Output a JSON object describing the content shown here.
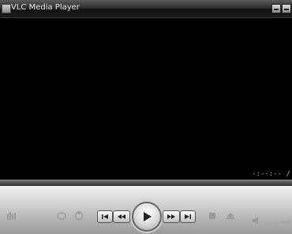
{
  "window": {
    "title": "VLC Media Player"
  },
  "player": {
    "time_display": "-:--:-- /"
  },
  "icons": {
    "app": "vlc-icon",
    "minimize": "minimize-icon",
    "close": "close-icon",
    "playlist": "playlist-icon",
    "loop": "loop-icon",
    "random": "random-icon",
    "skip_start": "skip-to-start-icon",
    "rewind": "rewind-icon",
    "play": "play-icon",
    "fast_forward": "fast-forward-icon",
    "skip_end": "skip-to-end-icon",
    "stop": "stop-icon",
    "eject": "eject-icon",
    "volume": "volume-icon"
  }
}
